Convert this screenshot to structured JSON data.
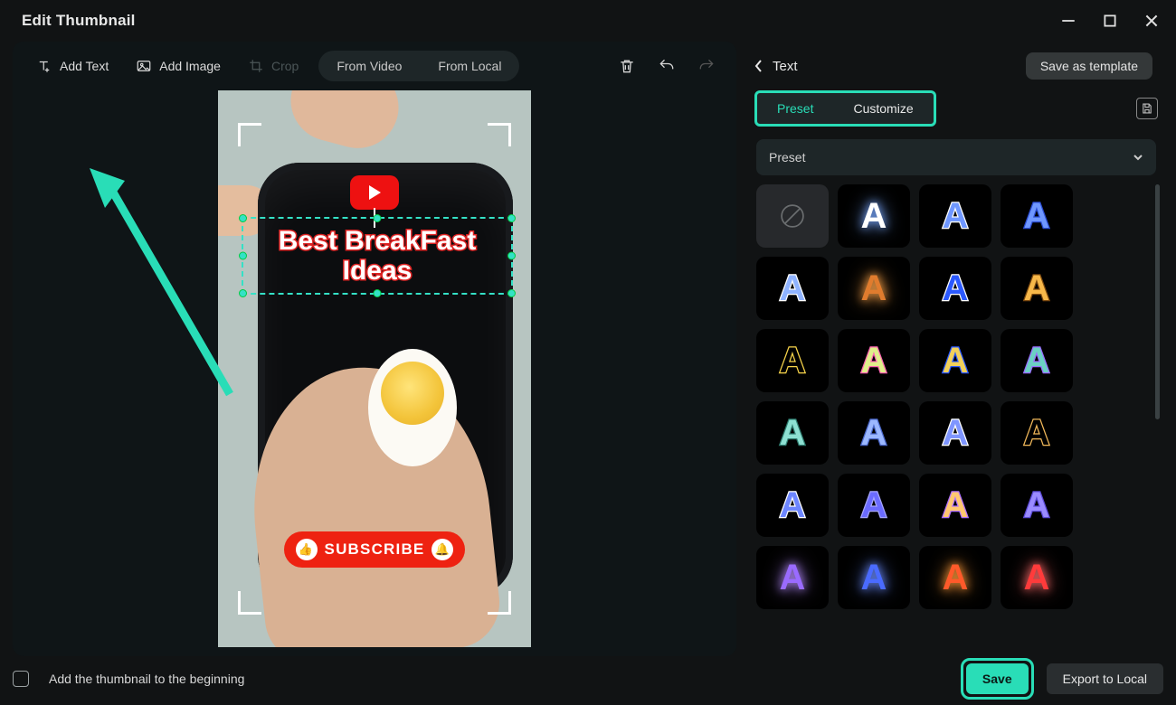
{
  "window": {
    "title": "Edit Thumbnail"
  },
  "toolbar": {
    "add_text": "Add Text",
    "add_image": "Add Image",
    "crop": "Crop",
    "from_video": "From Video",
    "from_local": "From Local"
  },
  "canvas": {
    "overlay_text": "Best BreakFast\nIdeas",
    "subscribe": "SUBSCRIBE"
  },
  "right": {
    "back_label": "Text",
    "save_template": "Save as template",
    "tab_preset": "Preset",
    "tab_customize": "Customize",
    "dropdown": "Preset"
  },
  "presets": [
    {
      "id": "none",
      "style": "none"
    },
    {
      "id": "p1",
      "fill": "#ffffff",
      "glow": "#7aa8ff"
    },
    {
      "id": "p2",
      "fill": "#6f97ff",
      "stroke": "#ffffff"
    },
    {
      "id": "p3",
      "fill": "#6f97ff",
      "stroke": "#2a4bd1"
    },
    {
      "id": "p4",
      "fill": "#8fb3ff",
      "stroke": "#ffffff"
    },
    {
      "id": "p5",
      "fill": "#e07c2e",
      "glow": "#ffa54a"
    },
    {
      "id": "p6",
      "fill": "#2b59ff",
      "stroke": "#ffffff"
    },
    {
      "id": "p7",
      "fill": "#f7b84a",
      "stroke": "#7d4a10"
    },
    {
      "id": "p8",
      "fill": "#000",
      "stroke": "#f6d34a"
    },
    {
      "id": "p9",
      "fill": "#dff08a",
      "stroke": "#ff66b3"
    },
    {
      "id": "p10",
      "fill": "#f3d15a",
      "stroke": "#2b59ff"
    },
    {
      "id": "p11",
      "fill": "#6bd0c3",
      "stroke": "#9a6bff"
    },
    {
      "id": "p12",
      "fill": "#8de0d2",
      "stroke": "#2e7c6f"
    },
    {
      "id": "p13",
      "fill": "#9cb8ff",
      "stroke": "#4a67c9"
    },
    {
      "id": "p14",
      "fill": "#7e95ff",
      "stroke": "#ffffff"
    },
    {
      "id": "p15",
      "fill": "#000",
      "stroke": "#f1b85a"
    },
    {
      "id": "p16",
      "fill": "#6d86ff",
      "stroke": "#ffffff"
    },
    {
      "id": "p17",
      "fill": "#6b6bff",
      "stroke": "#a7a7ff"
    },
    {
      "id": "p18",
      "fill": "#ffc870",
      "stroke": "#b070ff"
    },
    {
      "id": "p19",
      "fill": "#9a8bff",
      "stroke": "#5b4ad6"
    },
    {
      "id": "p20",
      "fill": "#9a6bff",
      "glow": "#b58bff"
    },
    {
      "id": "p21",
      "fill": "#4a6bff",
      "glow": "#6a8bff"
    },
    {
      "id": "p22",
      "fill": "#ff5a2a",
      "glow": "#ff9a3a"
    },
    {
      "id": "p23",
      "fill": "#ff3b3b",
      "glow": "#ff6b6b"
    }
  ],
  "preset_letter": "A",
  "footer": {
    "checkbox_label": "Add the thumbnail to the beginning",
    "save": "Save",
    "export": "Export to Local"
  },
  "colors": {
    "accent": "#29ddb7"
  }
}
